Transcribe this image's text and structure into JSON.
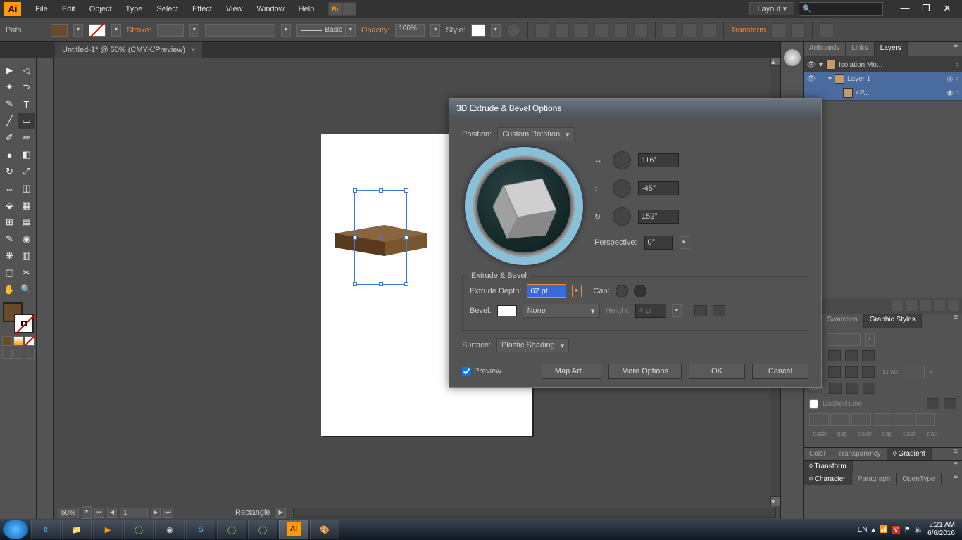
{
  "menubar": {
    "logo": "Ai",
    "items": [
      "File",
      "Edit",
      "Object",
      "Type",
      "Select",
      "Effect",
      "View",
      "Window",
      "Help"
    ],
    "layout": "Layout"
  },
  "optionsbar": {
    "path_label": "Path",
    "stroke_label": "Stroke:",
    "stroke_weight": "",
    "brush_label": "Basic",
    "opacity_label": "Opacity:",
    "opacity_val": "100%",
    "style_label": "Style:",
    "transform_label": "Transform"
  },
  "doc": {
    "tab_title": "Untitled-1* @ 50% (CMYK/Preview)",
    "layer_name": "Layer 1",
    "zoom": "50%",
    "page": "1",
    "status_tool": "Rectangle"
  },
  "panels": {
    "tabs": [
      "Artboards",
      "Links",
      "Layers"
    ],
    "layers": [
      {
        "name": "Isolation Mo...",
        "color": "#c49a6a",
        "indent": 0
      },
      {
        "name": "Layer 1",
        "color": "#c49a6a",
        "indent": 1
      },
      {
        "name": "<P...",
        "color": "#c49a6a",
        "indent": 2
      }
    ],
    "stroke_tabs": [
      ":e",
      "Swatches",
      "Graphic Styles"
    ],
    "stroke": {
      "weight_label": "ight:",
      "caps_label": "Cap:",
      "corner_label": "rner:",
      "limit_label": "Limit:",
      "align_label": "roke:",
      "dashed_label": "Dashed Line",
      "dg_labels": [
        "dash",
        "gap",
        "dash",
        "gap",
        "dash",
        "gap"
      ]
    },
    "bottom_tabs1": [
      "Color",
      "Transparency",
      "◊ Gradient"
    ],
    "bottom_tabs2": [
      "◊ Transform"
    ],
    "bottom_tabs3": [
      "◊ Character",
      "Paragraph",
      "OpenType"
    ]
  },
  "dialog": {
    "title": "3D Extrude & Bevel Options",
    "position_label": "Position:",
    "position_val": "Custom Rotation",
    "rot_x": "116°",
    "rot_y": "-45°",
    "rot_z": "152°",
    "perspective_label": "Perspective:",
    "perspective_val": "0°",
    "extrude_legend": "Extrude & Bevel",
    "depth_label": "Extrude Depth:",
    "depth_val": "62 pt",
    "cap_label": "Cap:",
    "bevel_label": "Bevel:",
    "bevel_val": "None",
    "height_label": "Height:",
    "height_val": "4 pt",
    "surface_label": "Surface:",
    "surface_val": "Plastic Shading",
    "preview_label": "Preview",
    "map_art": "Map Art...",
    "more_options": "More Options",
    "ok": "OK",
    "cancel": "Cancel"
  },
  "taskbar": {
    "lang": "EN",
    "time": "2:21 AM",
    "date": "6/6/2016"
  }
}
